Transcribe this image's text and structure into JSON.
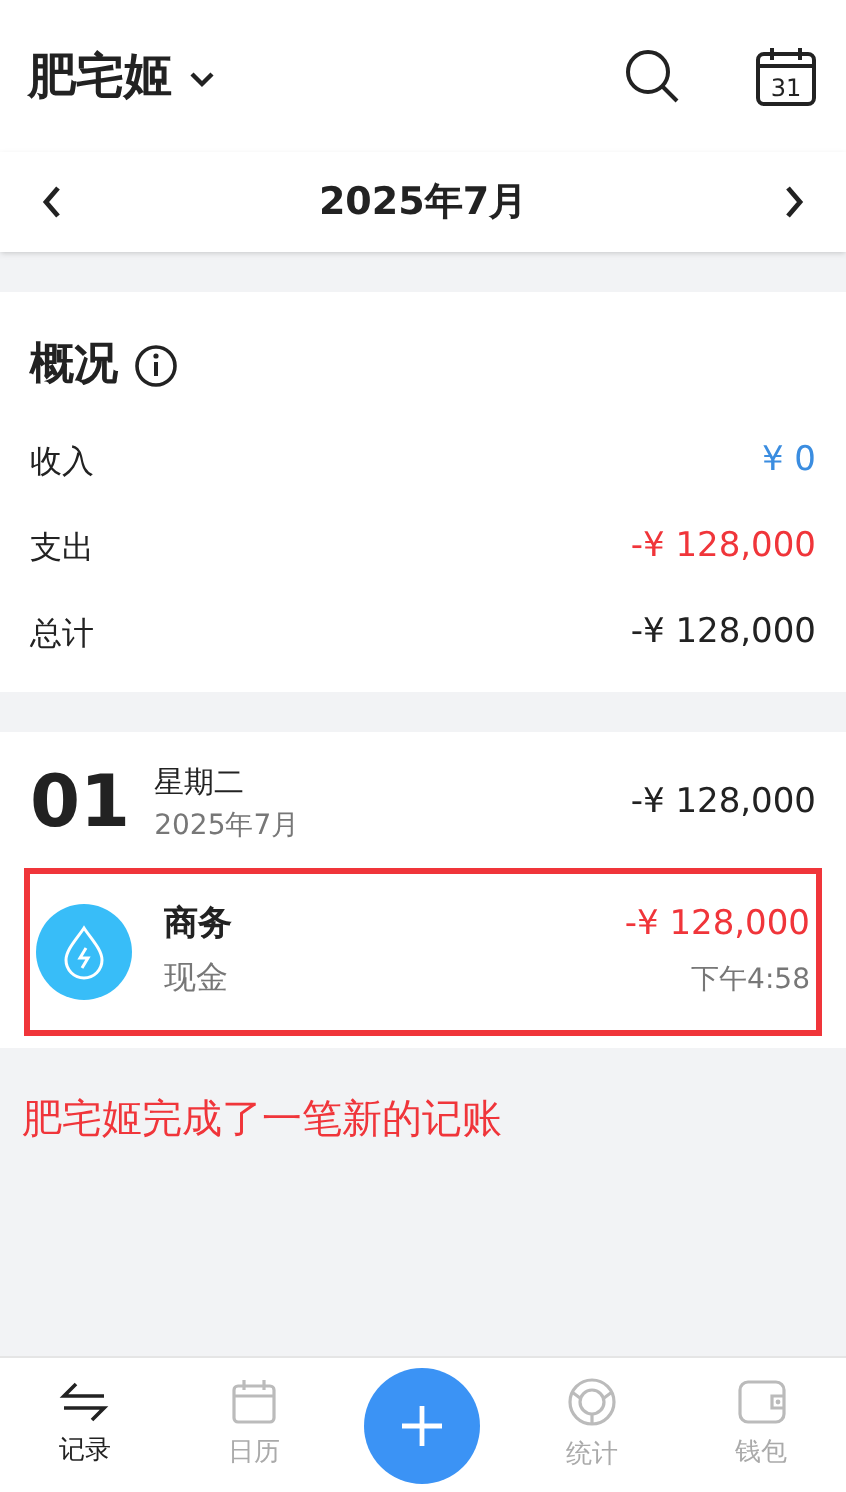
{
  "header": {
    "title": "肥宅姬",
    "calendar_day": "31"
  },
  "month_bar": {
    "label": "2025年7月"
  },
  "summary": {
    "title": "概况",
    "rows": [
      {
        "label": "收入",
        "value": "¥ 0",
        "kind": "income"
      },
      {
        "label": "支出",
        "value": "-¥ 128,000",
        "kind": "expense"
      },
      {
        "label": "总计",
        "value": "-¥ 128,000",
        "kind": "total"
      }
    ]
  },
  "day": {
    "date": "01",
    "weekday": "星期二",
    "month": "2025年7月",
    "total": "-¥ 128,000",
    "entries": [
      {
        "category": "商务",
        "account": "现金",
        "amount": "-¥ 128,000",
        "time": "下午4:58",
        "color": "#38bdf8",
        "highlighted": true
      }
    ]
  },
  "annotation": "肥宅姬完成了一笔新的记账",
  "bottom_nav": [
    {
      "label": "记录",
      "kind": "records",
      "selected": true
    },
    {
      "label": "日历",
      "kind": "calendar",
      "selected": false
    },
    {
      "kind": "add"
    },
    {
      "label": "统计",
      "kind": "stats",
      "selected": false
    },
    {
      "label": "钱包",
      "kind": "wallet",
      "selected": false
    }
  ]
}
